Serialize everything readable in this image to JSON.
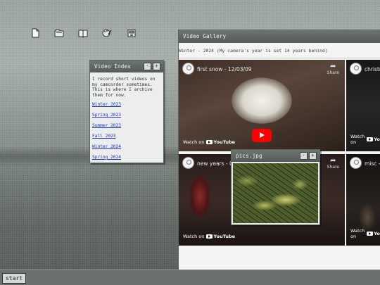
{
  "desktop": {
    "icons": [
      "document-icon",
      "folder-icon",
      "book-icon",
      "paint-icon",
      "archive-icon"
    ]
  },
  "video_index": {
    "title": "Video Index",
    "intro": "I record short videos on my camcorder sometimes. This is where I archive them for now.",
    "links": [
      "Winter 2023",
      "Spring 2023",
      "Summer 2023",
      "Fall 2023",
      "Winter 2024",
      "Spring 2024"
    ]
  },
  "gallery": {
    "title": "Video Gallery",
    "subtitle": "Winter - 2024 (My camera's year is set 14 years behind)",
    "videos": [
      {
        "title": "first snow - 12/03/09",
        "watch": "Watch on",
        "brand": "YouTube",
        "share": "Share"
      },
      {
        "title": "christm",
        "watch": "Watch on",
        "brand": "YouTube",
        "share": ""
      },
      {
        "title": "new years - 01",
        "watch": "Watch on",
        "brand": "YouTube",
        "share": "Share"
      },
      {
        "title": "misc -",
        "watch": "Watch on",
        "brand": "YouTube",
        "share": ""
      }
    ]
  },
  "pics_window": {
    "title": "pics.jpg"
  },
  "window_buttons": {
    "minimize": "-",
    "maximize": "+"
  },
  "taskbar": {
    "start": "start"
  }
}
